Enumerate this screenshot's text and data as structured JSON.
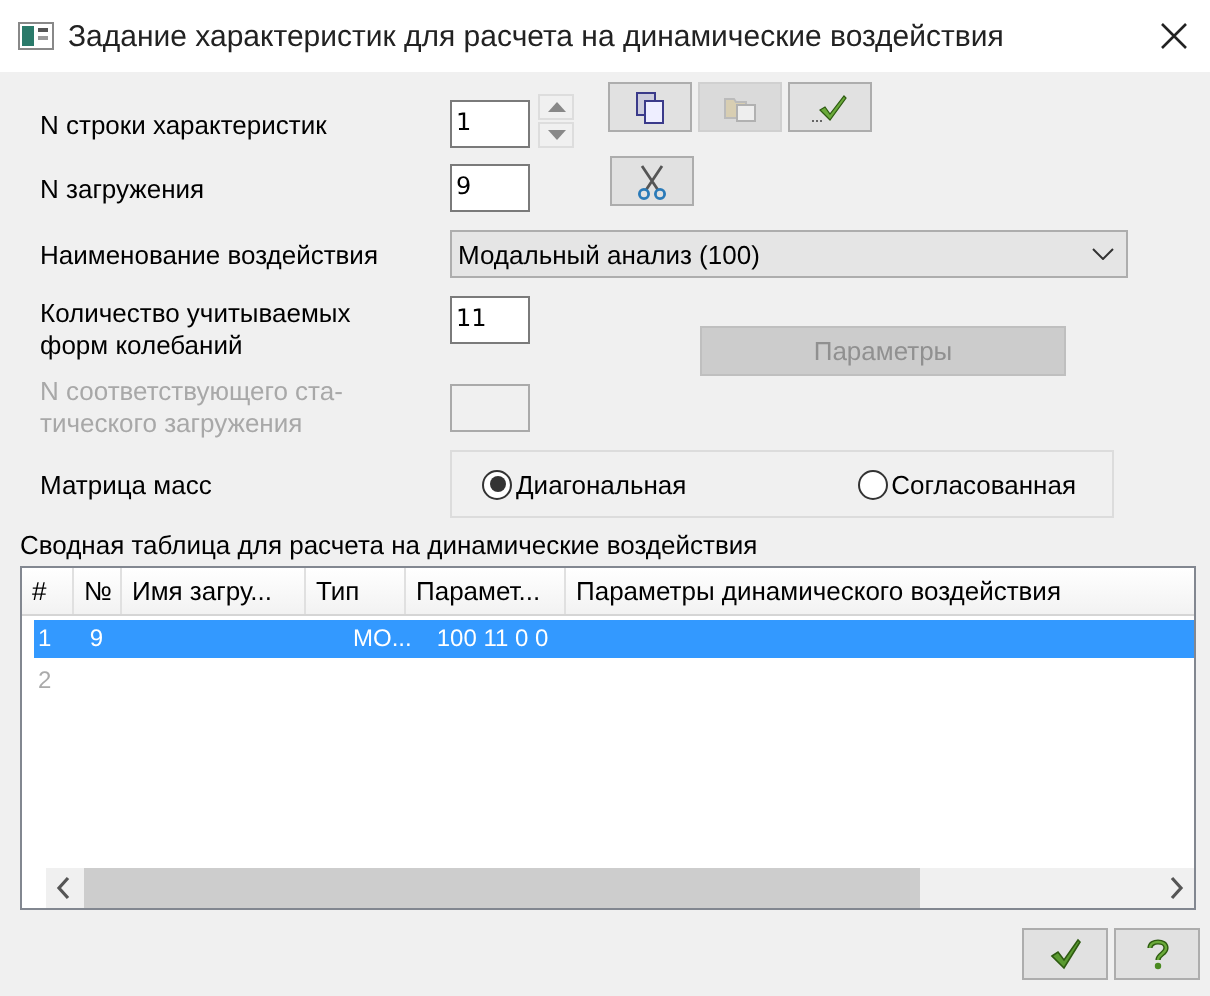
{
  "window": {
    "title": "Задание характеристик для расчета на динамические воздействия"
  },
  "row_number": {
    "label": "N строки характеристик",
    "value": "1"
  },
  "load_number": {
    "label": "N загружения",
    "value": "9"
  },
  "toolbar": [
    {
      "kind": "copy",
      "disabled": false
    },
    {
      "kind": "paste",
      "disabled": true
    },
    {
      "kind": "apply",
      "disabled": false
    },
    {
      "kind": "cut",
      "disabled": false
    }
  ],
  "action_name": {
    "label": "Наименование воздействия",
    "value": "Модальный анализ (100)"
  },
  "modes_count": {
    "label": "Количество учитываемых форм колебаний",
    "value": "11"
  },
  "parameters_button": {
    "label": "Параметры",
    "disabled": true
  },
  "static_load": {
    "label": "N соответствующего ста-тического загружения",
    "disabled": true
  },
  "mass_matrix": {
    "label": "Матрица масс",
    "options": [
      {
        "label": "Диагональная",
        "selected": true
      },
      {
        "label": "Согласованная",
        "selected": false
      }
    ]
  },
  "table": {
    "caption": "Сводная таблица для расчета на динамические воздействия",
    "columns": [
      "#",
      "№",
      "Имя загру...",
      "Тип",
      "Парамет...",
      "Параметры динамического воздействия"
    ],
    "rows": [
      {
        "selected": true,
        "cells": [
          "1",
          "9",
          null,
          "МО...",
          "100 11 0  0",
          null
        ]
      },
      {
        "selected": false,
        "cells": [
          "2",
          null,
          null,
          null,
          null,
          null
        ]
      }
    ]
  },
  "buttons": [
    {
      "kind": "ok"
    },
    {
      "kind": "help"
    }
  ]
}
